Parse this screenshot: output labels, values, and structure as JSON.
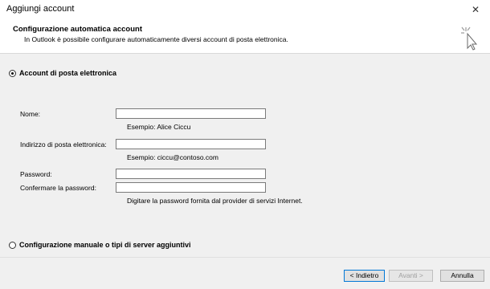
{
  "window": {
    "title": "Aggiungi account",
    "close_glyph": "✕"
  },
  "header": {
    "title": "Configurazione automatica account",
    "subtitle": "In Outlook è possibile configurare automaticamente diversi account di posta elettronica.",
    "icon": "wizard-cursor-icon"
  },
  "options": {
    "email_account": {
      "label": "Account di posta elettronica",
      "checked": true
    },
    "manual": {
      "label": "Configurazione manuale o tipi di server aggiuntivi",
      "checked": false
    }
  },
  "form": {
    "name": {
      "label": "Nome:",
      "value": "",
      "hint": "Esempio: Alice Ciccu"
    },
    "email": {
      "label": "Indirizzo di posta elettronica:",
      "value": "",
      "hint": "Esempio: ciccu@contoso.com"
    },
    "password": {
      "label": "Password:",
      "value": ""
    },
    "confirm_password": {
      "label": "Confermare la password:",
      "value": ""
    },
    "password_hint": "Digitare la password fornita dal provider di servizi Internet."
  },
  "buttons": {
    "back": "< Indietro",
    "next": "Avanti >",
    "cancel": "Annulla"
  },
  "colors": {
    "content_bg": "#f0f0f0",
    "default_button_border": "#0078d7"
  }
}
